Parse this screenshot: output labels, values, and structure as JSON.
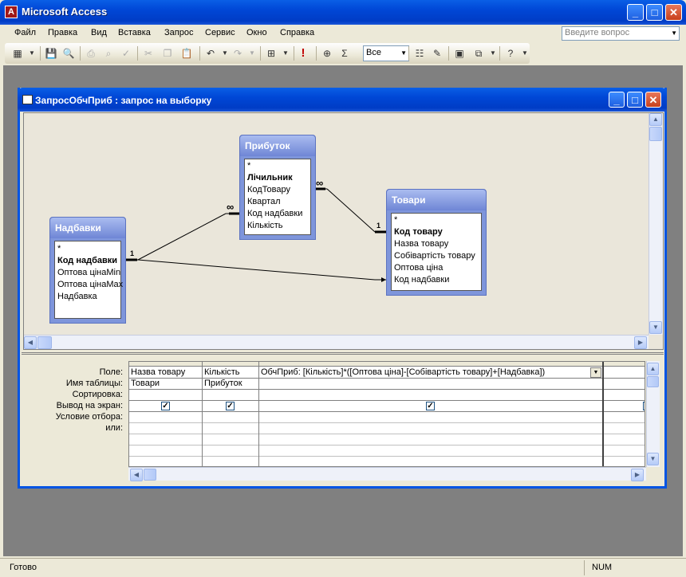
{
  "app": {
    "title": "Microsoft Access",
    "icon_letter": "A"
  },
  "window_buttons": {
    "minimize": "_",
    "maximize": "□",
    "close": "✕"
  },
  "menu": [
    "Файл",
    "Правка",
    "Вид",
    "Вставка",
    "Запрос",
    "Сервис",
    "Окно",
    "Справка"
  ],
  "ask_box": {
    "placeholder": "Введите вопрос"
  },
  "toolbar": {
    "combo_value": "Все",
    "sigma": "Σ",
    "run": "!"
  },
  "query_window": {
    "title": "ЗапросОбчПриб : запрос на выборку"
  },
  "tables": {
    "nadbavky": {
      "title": "Надбавки",
      "fields": [
        "*",
        "Код надбавки",
        "Оптова цінаMin",
        "Оптова цінаMax",
        "Надбавка"
      ]
    },
    "prybutok": {
      "title": "Прибуток",
      "fields": [
        "*",
        "Лічильник",
        "КодТовару",
        "Квартал",
        "Код надбавки",
        "Кількість"
      ]
    },
    "tovary": {
      "title": "Товари",
      "fields": [
        "*",
        "Код товару",
        "Назва товару",
        "Собівартість товару",
        "Оптова ціна",
        "Код надбавки"
      ]
    }
  },
  "relations": {
    "one": "1",
    "many": "∞"
  },
  "grid": {
    "row_labels": [
      "Поле:",
      "Имя таблицы:",
      "Сортировка:",
      "Вывод на экран:",
      "Условие отбора:",
      "или:"
    ],
    "columns": [
      {
        "field": "Назва товару",
        "table": "Товари",
        "show": true
      },
      {
        "field": "Кількість",
        "table": "Прибуток",
        "show": true
      },
      {
        "field": "ОбчПриб: [Кількість]*([Оптова ціна]-[Собівартість товару]+[Надбавка])",
        "table": "",
        "show": true
      }
    ]
  },
  "status": {
    "left": "Готово",
    "num": "NUM"
  }
}
